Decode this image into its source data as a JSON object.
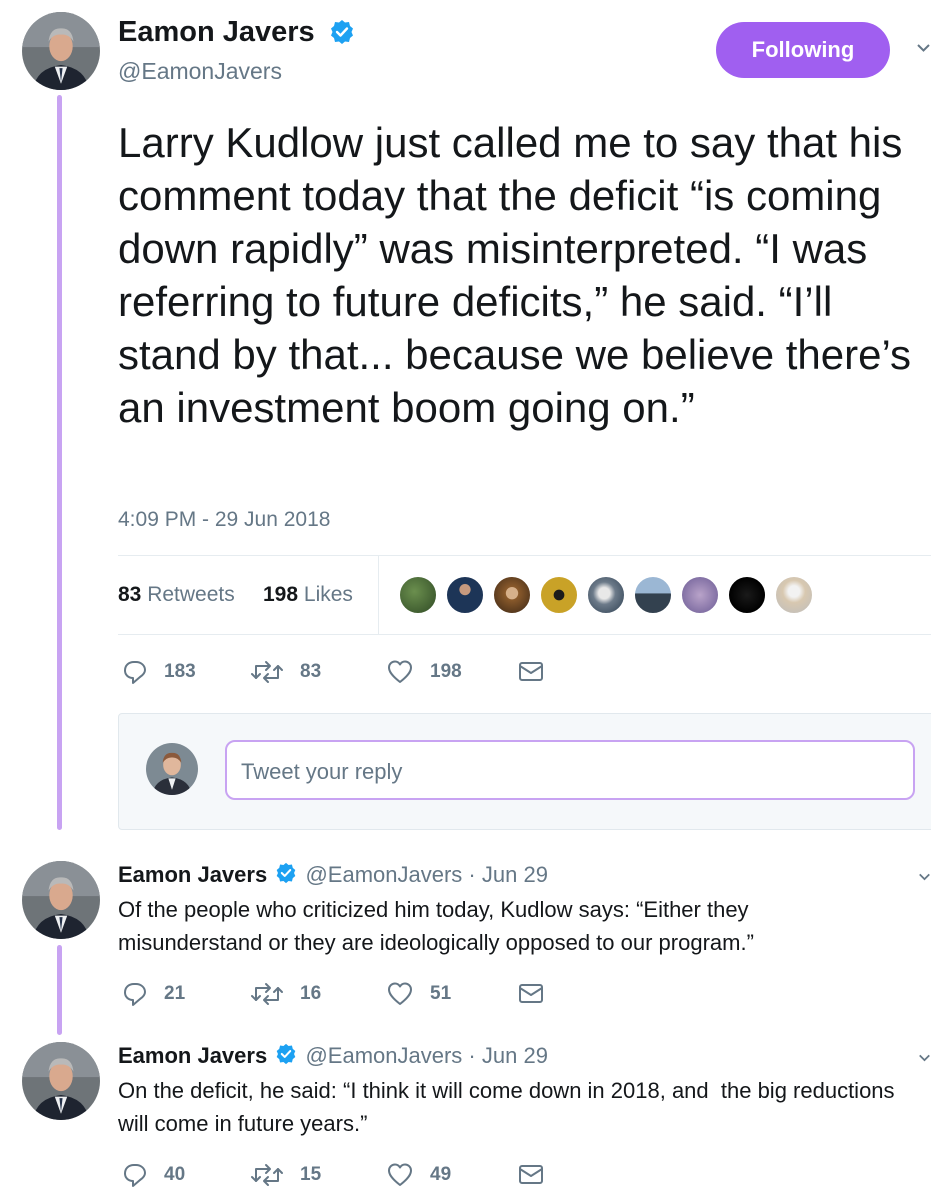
{
  "colors": {
    "accent": "#a05ff0",
    "thread_line": "#c8a3f2",
    "verified": "#1da1f2",
    "muted": "#657786"
  },
  "main_tweet": {
    "author_name": "Eamon Javers",
    "author_handle": "@EamonJavers",
    "follow_label": "Following",
    "text": "Larry Kudlow just called me to say that his comment today that the deficit “is coming down rapidly” was misinterpreted. “I was referring to future deficits,” he said. “I’ll stand by that... because we believe there’s an investment boom going on.”",
    "timestamp": "4:09 PM - 29 Jun 2018",
    "retweets_count": "83",
    "retweets_label": "Retweets",
    "likes_count": "198",
    "likes_label": "Likes",
    "actions": {
      "replies": "183",
      "retweets": "83",
      "likes": "198"
    },
    "icons": [
      "verified-badge-icon",
      "chevron-down-icon",
      "reply-icon",
      "retweet-icon",
      "like-icon",
      "message-icon"
    ]
  },
  "reply_composer": {
    "placeholder": "Tweet your reply"
  },
  "replies": [
    {
      "author_name": "Eamon Javers",
      "author_handle": "@EamonJavers",
      "separator": "·",
      "date": "Jun 29",
      "text": "Of the people who criticized him today, Kudlow says: “Either they misunderstand or they are ideologically opposed to our program.”",
      "replies": "21",
      "retweets": "16",
      "likes": "51"
    },
    {
      "author_name": "Eamon Javers",
      "author_handle": "@EamonJavers",
      "separator": "·",
      "date": "Jun 29",
      "text": "On the deficit, he said: “I think it will come down in 2018, and  the big reductions will come in future years.”",
      "replies": "40",
      "retweets": "15",
      "likes": "49"
    }
  ]
}
